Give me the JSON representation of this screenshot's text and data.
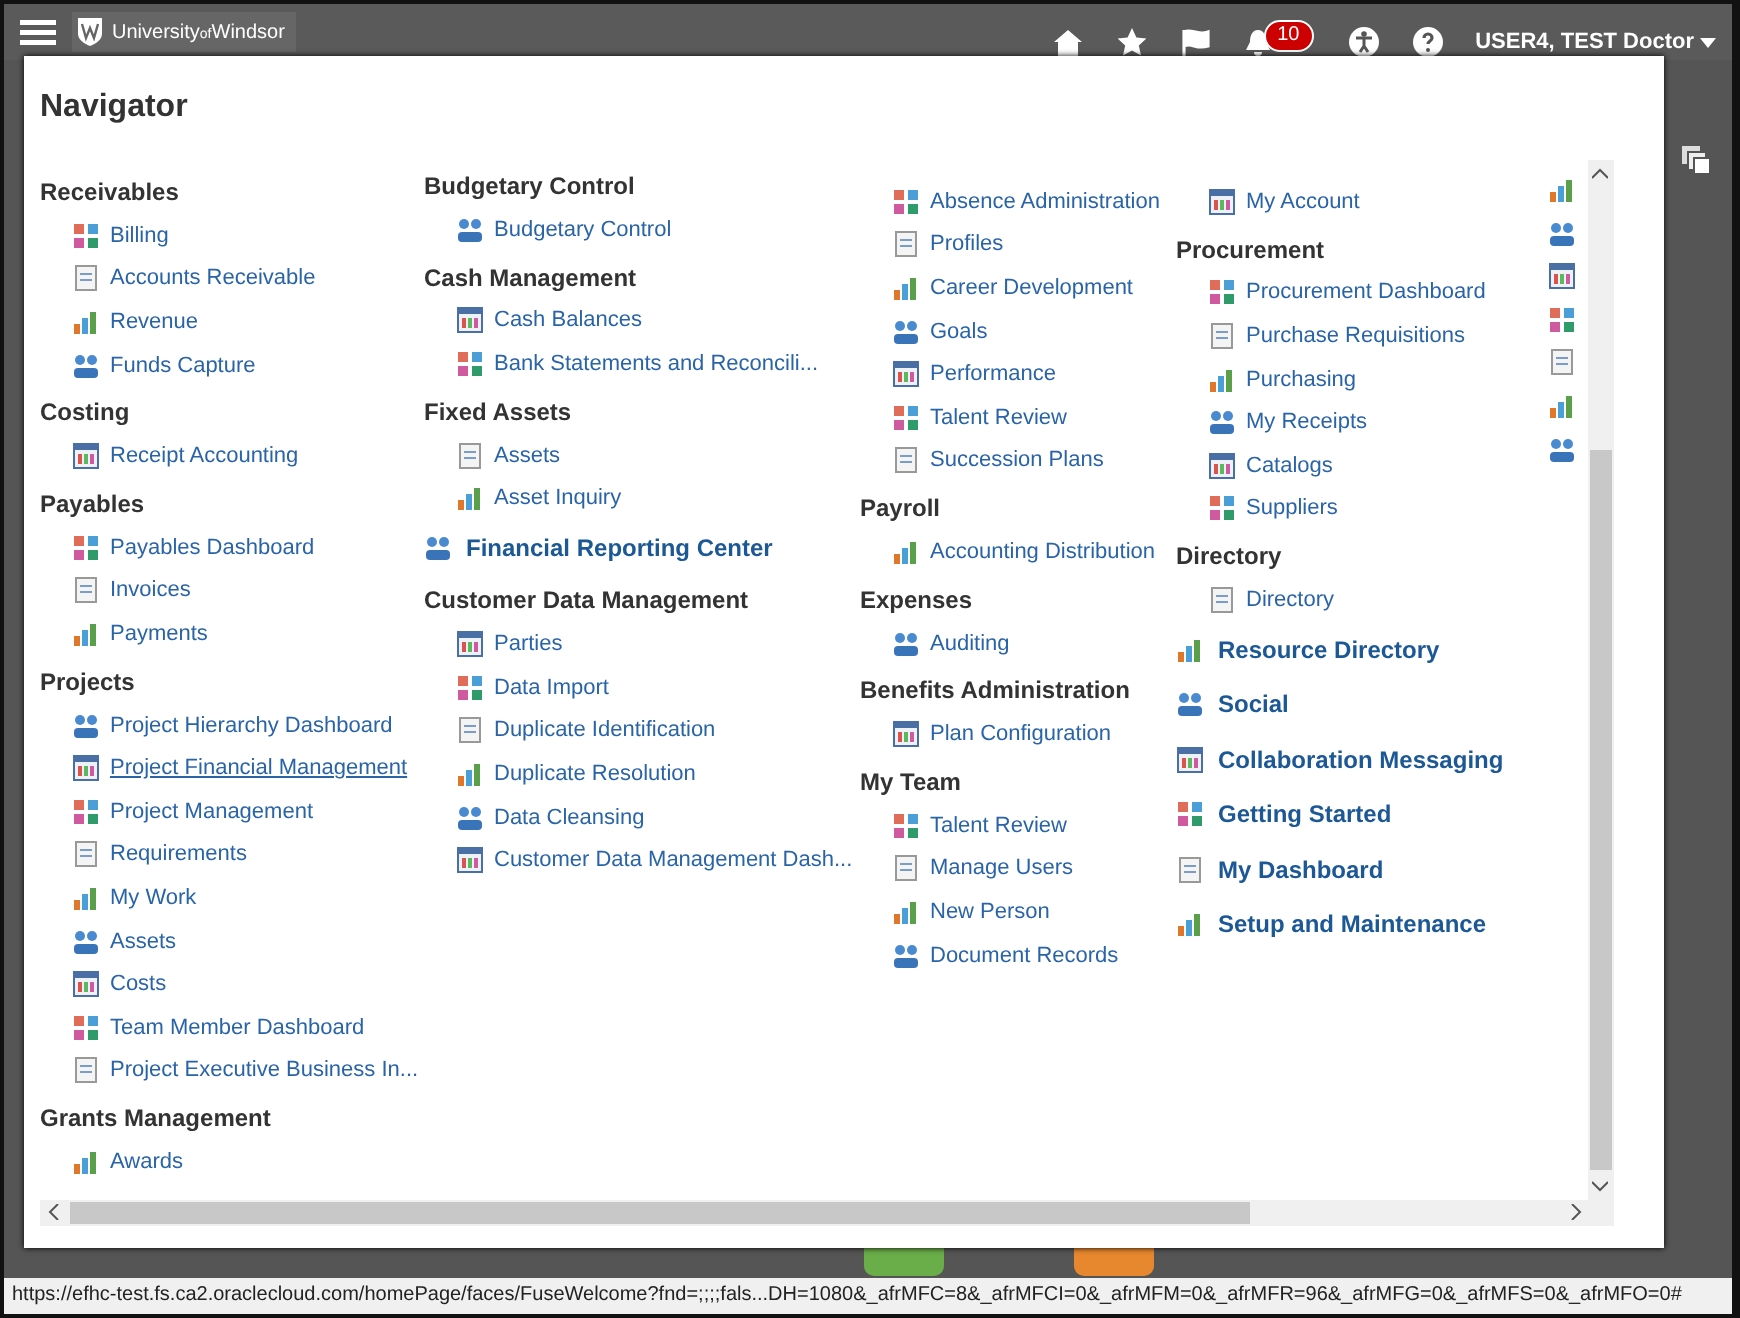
{
  "header": {
    "logo": "University$_{of}$Windsor",
    "notifications_badge": "10",
    "user": "USER4, TEST Doctor"
  },
  "navigator": {
    "title": "Navigator",
    "columns": [
      {
        "entries": [
          {
            "kind": "group",
            "title": "Receivables",
            "items": [
              {
                "label": "Billing",
                "hovered": false
              },
              {
                "label": "Accounts Receivable",
                "hovered": false
              },
              {
                "label": "Revenue",
                "hovered": false
              },
              {
                "label": "Funds Capture",
                "hovered": false
              }
            ]
          },
          {
            "kind": "group",
            "title": "Costing",
            "items": [
              {
                "label": "Receipt Accounting",
                "hovered": false
              }
            ]
          },
          {
            "kind": "group",
            "title": "Payables",
            "items": [
              {
                "label": "Payables Dashboard",
                "hovered": false
              },
              {
                "label": "Invoices",
                "hovered": false
              },
              {
                "label": "Payments",
                "hovered": false
              }
            ]
          },
          {
            "kind": "group",
            "title": "Projects",
            "items": [
              {
                "label": "Project Hierarchy Dashboard",
                "hovered": false
              },
              {
                "label": "Project Financial Management",
                "hovered": true
              },
              {
                "label": "Project Management",
                "hovered": false
              },
              {
                "label": "Requirements",
                "hovered": false
              },
              {
                "label": "My Work",
                "hovered": false
              },
              {
                "label": "Assets",
                "hovered": false
              },
              {
                "label": "Costs",
                "hovered": false
              },
              {
                "label": "Team Member Dashboard",
                "hovered": false
              },
              {
                "label": "Project Executive Business In...",
                "hovered": false
              }
            ]
          },
          {
            "kind": "group",
            "title": "Grants Management",
            "items": [
              {
                "label": "Awards",
                "hovered": false
              }
            ]
          }
        ]
      },
      {
        "entries": [
          {
            "kind": "group",
            "title": "Budgetary Control",
            "items": [
              {
                "label": "Budgetary Control",
                "hovered": false
              }
            ]
          },
          {
            "kind": "group",
            "title": "Cash Management",
            "items": [
              {
                "label": "Cash Balances",
                "hovered": false
              },
              {
                "label": "Bank Statements and Reconcili...",
                "hovered": false
              }
            ]
          },
          {
            "kind": "group",
            "title": "Fixed Assets",
            "items": [
              {
                "label": "Assets",
                "hovered": false
              },
              {
                "label": "Asset Inquiry",
                "hovered": false
              }
            ]
          },
          {
            "kind": "link",
            "label": "Financial Reporting Center"
          },
          {
            "kind": "group",
            "title": "Customer Data Management",
            "items": [
              {
                "label": "Parties",
                "hovered": false
              },
              {
                "label": "Data Import",
                "hovered": false
              },
              {
                "label": "Duplicate Identification",
                "hovered": false
              },
              {
                "label": "Duplicate Resolution",
                "hovered": false
              },
              {
                "label": "Data Cleansing",
                "hovered": false
              },
              {
                "label": "Customer Data Management Dash...",
                "hovered": false
              }
            ]
          }
        ]
      },
      {
        "entries": [
          {
            "kind": "group",
            "items": [
              {
                "label": "Absence Administration",
                "hovered": false
              },
              {
                "label": "Profiles",
                "hovered": false
              },
              {
                "label": "Career Development",
                "hovered": false
              },
              {
                "label": "Goals",
                "hovered": false
              },
              {
                "label": "Performance",
                "hovered": false
              },
              {
                "label": "Talent Review",
                "hovered": false
              },
              {
                "label": "Succession Plans",
                "hovered": false
              }
            ]
          },
          {
            "kind": "group",
            "title": "Payroll",
            "items": [
              {
                "label": "Accounting Distribution",
                "hovered": false
              }
            ]
          },
          {
            "kind": "group",
            "title": "Expenses",
            "items": [
              {
                "label": "Auditing",
                "hovered": false
              }
            ]
          },
          {
            "kind": "group",
            "title": "Benefits Administration",
            "items": [
              {
                "label": "Plan Configuration",
                "hovered": false
              }
            ]
          },
          {
            "kind": "group",
            "title": "My Team",
            "items": [
              {
                "label": "Talent Review",
                "hovered": false
              },
              {
                "label": "Manage Users",
                "hovered": false
              },
              {
                "label": "New Person",
                "hovered": false
              },
              {
                "label": "Document Records",
                "hovered": false
              }
            ]
          }
        ]
      },
      {
        "entries": [
          {
            "kind": "group",
            "items": [
              {
                "label": "My Account",
                "hovered": false
              }
            ]
          },
          {
            "kind": "group",
            "title": "Procurement",
            "items": [
              {
                "label": "Procurement Dashboard",
                "hovered": false
              },
              {
                "label": "Purchase Requisitions",
                "hovered": false
              },
              {
                "label": "Purchasing",
                "hovered": false
              },
              {
                "label": "My Receipts",
                "hovered": false
              },
              {
                "label": "Catalogs",
                "hovered": false
              },
              {
                "label": "Suppliers",
                "hovered": false
              }
            ]
          },
          {
            "kind": "group",
            "title": "Directory",
            "items": [
              {
                "label": "Directory",
                "hovered": false
              }
            ]
          },
          {
            "kind": "link",
            "label": "Resource Directory"
          },
          {
            "kind": "link",
            "label": "Social"
          },
          {
            "kind": "link",
            "label": "Collaboration Messaging"
          },
          {
            "kind": "link",
            "label": "Getting Started"
          },
          {
            "kind": "link",
            "label": "My Dashboard"
          },
          {
            "kind": "link",
            "label": "Setup and Maintenance"
          }
        ]
      }
    ]
  },
  "status_bar": {
    "url": "https://efhc-test.fs.ca2.oraclecloud.com/homePage/faces/FuseWelcome?fnd=;;;;fals...DH=1080&_afrMFC=8&_afrMFCI=0&_afrMFM=0&_afrMFR=96&_afrMFG=0&_afrMFS=0&_afrMFO=0#"
  }
}
